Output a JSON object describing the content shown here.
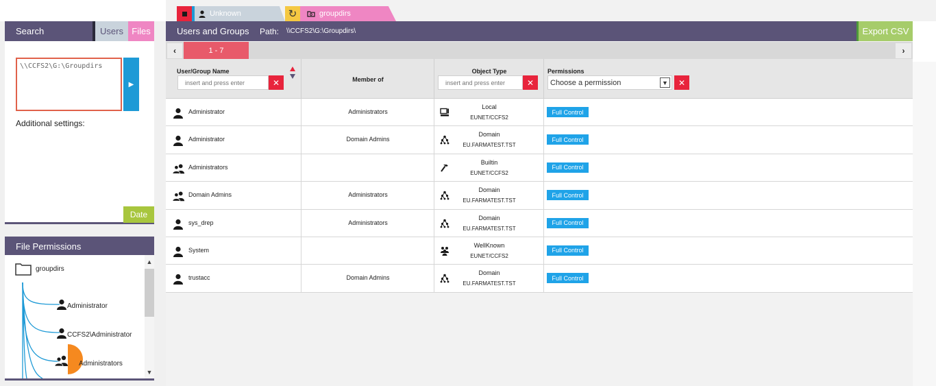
{
  "tabs": {
    "unknown_label": "Unknown",
    "groupdirs_label": "groupdirs",
    "reload_icon": "refresh-icon"
  },
  "search": {
    "title": "Search",
    "users_label": "Users",
    "files_label": "Files",
    "path_value": "\\\\CCFS2\\G:\\Groupdirs",
    "additional_settings": "Additional settings:",
    "date_label": "Date"
  },
  "file_permissions": {
    "title": "File Permissions",
    "root": "groupdirs",
    "nodes": [
      "Administrator",
      "CCFS2\\Administrator",
      "Administrators"
    ]
  },
  "main": {
    "title": "Users and Groups",
    "path_label": "Path:",
    "path_value": "\\\\CCFS2\\G:\\Groupdirs\\",
    "export_label": "Export CSV",
    "pager_range": "1 - 7",
    "prev": "‹",
    "next": "›"
  },
  "table": {
    "columns": {
      "name": "User/Group Name",
      "member": "Member of",
      "type": "Object Type",
      "perm": "Permissions"
    },
    "name_filter_placeholder": "insert and press enter",
    "type_filter_placeholder": "insert and press enter",
    "perm_select_value": "Choose a permission",
    "rows": [
      {
        "name": "Administrator",
        "member": "Administrators",
        "type": "Local",
        "domain": "EUNET/CCFS2",
        "perm": "Full Control",
        "kind": "user",
        "type_icon": "computer-icon"
      },
      {
        "name": "Administrator",
        "member": "Domain Admins",
        "type": "Domain",
        "domain": "EU.FARMATEST.TST",
        "perm": "Full Control",
        "kind": "user",
        "type_icon": "network-icon"
      },
      {
        "name": "Administrators",
        "member": "",
        "type": "Builtin",
        "domain": "EUNET/CCFS2",
        "perm": "Full Control",
        "kind": "group",
        "type_icon": "hammer-icon"
      },
      {
        "name": "Domain Admins",
        "member": "Administrators",
        "type": "Domain",
        "domain": "EU.FARMATEST.TST",
        "perm": "Full Control",
        "kind": "group",
        "type_icon": "network-icon"
      },
      {
        "name": "sys_drep",
        "member": "Administrators",
        "type": "Domain",
        "domain": "EU.FARMATEST.TST",
        "perm": "Full Control",
        "kind": "user",
        "type_icon": "network-icon"
      },
      {
        "name": "System",
        "member": "",
        "type": "WellKnown",
        "domain": "EUNET/CCFS2",
        "perm": "Full Control",
        "kind": "user",
        "type_icon": "people-icon"
      },
      {
        "name": "trustacc",
        "member": "Domain Admins",
        "type": "Domain",
        "domain": "EU.FARMATEST.TST",
        "perm": "Full Control",
        "kind": "user",
        "type_icon": "network-icon"
      }
    ]
  },
  "colors": {
    "header": "#5b5478",
    "accent_blue": "#1e9ad6",
    "accent_red": "#e8243c",
    "accent_pink": "#ef86c3",
    "accent_green": "#a6cc6a",
    "accent_yellow": "#f5c842",
    "node_orange": "#f5891f"
  }
}
